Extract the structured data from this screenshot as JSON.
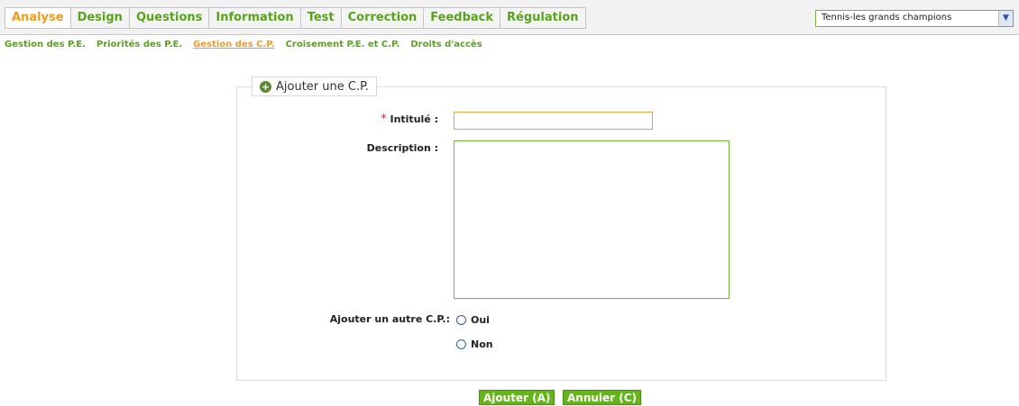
{
  "tabs": [
    {
      "label": "Analyse",
      "active": true
    },
    {
      "label": "Design",
      "active": false
    },
    {
      "label": "Questions",
      "active": false
    },
    {
      "label": "Information",
      "active": false
    },
    {
      "label": "Test",
      "active": false
    },
    {
      "label": "Correction",
      "active": false
    },
    {
      "label": "Feedback",
      "active": false
    },
    {
      "label": "Régulation",
      "active": false
    }
  ],
  "project_select": {
    "value": "Tennis-les grands champions"
  },
  "subnav": [
    {
      "label": "Gestion des P.E.",
      "active": false
    },
    {
      "label": "Priorités des P.E.",
      "active": false
    },
    {
      "label": "Gestion des C.P.",
      "active": true
    },
    {
      "label": "Croisement P.E. et C.P.",
      "active": false
    },
    {
      "label": "Droits d'accès",
      "active": false
    }
  ],
  "form": {
    "legend": "Ajouter une C.P.",
    "required_mark": "*",
    "title_label": "Intitulé :",
    "description_label": "Description :",
    "another_label": "Ajouter un autre C.P.:",
    "option_yes": "Oui",
    "option_no": "Non"
  },
  "buttons": {
    "add": "Ajouter (A)",
    "cancel": "Annuler (C)"
  },
  "colors": {
    "accent_green": "#58a31c",
    "active_orange": "#f29b1d",
    "button_green": "#65b41b"
  }
}
